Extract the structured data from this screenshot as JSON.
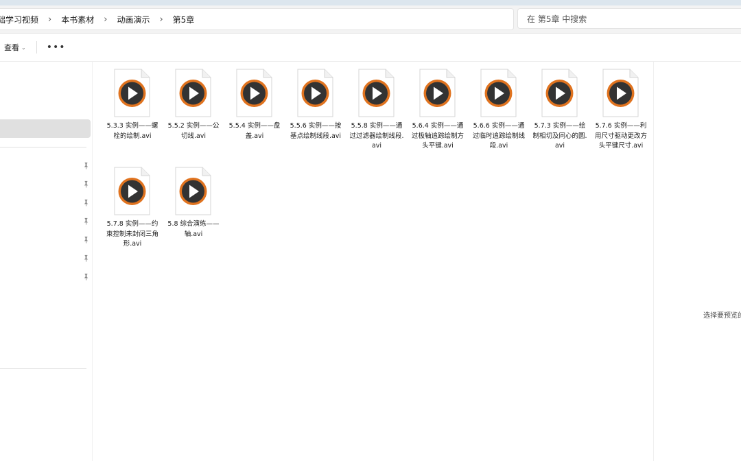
{
  "breadcrumb": {
    "items": [
      "础学习视频",
      "本书素材",
      "动画演示",
      "第5章"
    ]
  },
  "search": {
    "placeholder": "在 第5章 中搜索"
  },
  "toolbar": {
    "view_label": "查看",
    "more_label": "•••"
  },
  "files": [
    {
      "name": "5.3.3 实例——螺栓的绘制.avi"
    },
    {
      "name": "5.5.2 实例——公切线.avi"
    },
    {
      "name": "5.5.4 实例——盘盖.avi"
    },
    {
      "name": "5.5.6 实例——按基点绘制线段.avi"
    },
    {
      "name": "5.5.8 实例——通过过滤器绘制线段.avi"
    },
    {
      "name": "5.6.4 实例——通过极轴追踪绘制方头平键.avi"
    },
    {
      "name": "5.6.6 实例——通过临时追踪绘制线段.avi"
    },
    {
      "name": "5.7.3 实例——绘制相切及同心的圆.avi"
    },
    {
      "name": "5.7.6 实例——利用尺寸驱动更改方头平键尺寸.avi"
    },
    {
      "name": "5.7.8 实例——约束控制未封闭三角形.avi"
    },
    {
      "name": "5.8 综合演练——轴.avi"
    }
  ],
  "preview": {
    "empty_text": "选择要预览的"
  },
  "colors": {
    "play_ring": "#e0731f",
    "play_center": "#333333"
  }
}
